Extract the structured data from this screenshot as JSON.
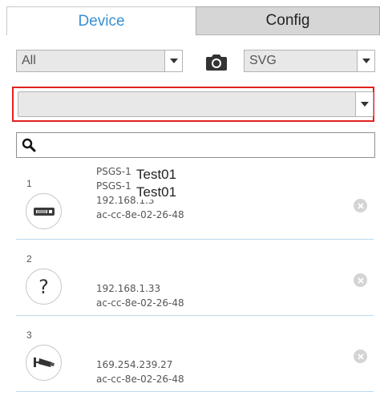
{
  "tabs": [
    {
      "label": "Device",
      "active": true
    },
    {
      "label": "Config",
      "active": false
    }
  ],
  "filter_select": {
    "value": "All"
  },
  "format_select": {
    "value": "SVG"
  },
  "network_select": {
    "value": ""
  },
  "search": {
    "value": "",
    "placeholder": ""
  },
  "devices": [
    {
      "index": "1",
      "icon": "switch-icon",
      "lines": [
        "PSGS-1",
        "PSGS-1",
        "192.168.1.3",
        "ac-cc-8e-02-26-48"
      ],
      "overlay": [
        "Test01",
        "Test01"
      ]
    },
    {
      "index": "2",
      "icon": "unknown-device-icon",
      "lines": [
        "192.168.1.33",
        "ac-cc-8e-02-26-48"
      ]
    },
    {
      "index": "3",
      "icon": "camera-device-icon",
      "lines": [
        "169.254.239.27",
        "ac-cc-8e-02-26-48"
      ]
    }
  ],
  "colors": {
    "active_tab_text": "#3a8fd1",
    "highlight_frame": "#e32121",
    "row_divider": "#bcd9ee"
  }
}
